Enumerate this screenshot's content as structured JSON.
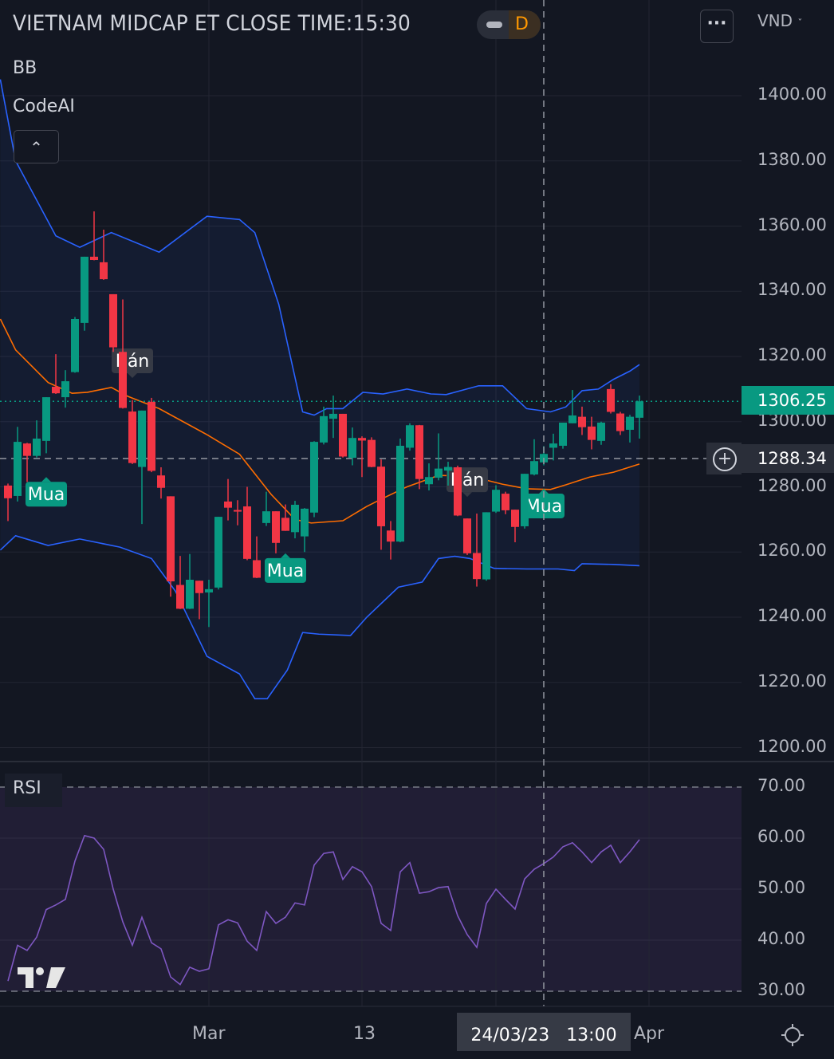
{
  "header": {
    "title": "VIETNAM MIDCAP ET CLOSE TIME:15:30",
    "interval": "D",
    "currency": "VND",
    "more_icon": "ellipsis-icon"
  },
  "legend": {
    "items": [
      "BB",
      "CodeAI"
    ],
    "collapse_icon": "chevron-up-icon",
    "rsi": "RSI"
  },
  "colors": {
    "up": "#089981",
    "down": "#f23645",
    "bb_band": "#2962ff",
    "bb_basis": "#ff6d00",
    "rsi": "#7e57c2",
    "price_tag": "#089981"
  },
  "price_axis": {
    "ticks": [
      "1400.00",
      "1380.00",
      "1360.00",
      "1340.00",
      "1320.00",
      "1300.00",
      "1280.00",
      "1260.00",
      "1240.00",
      "1220.00",
      "1200.00"
    ],
    "current": "1306.25",
    "crosshair": "1288.34"
  },
  "rsi_axis": {
    "ticks": [
      "70.00",
      "60.00",
      "50.00",
      "40.00",
      "30.00"
    ]
  },
  "time_axis": {
    "labels": [
      "Mar",
      "13",
      "Apr"
    ],
    "crosshair_date": "24/03/23",
    "crosshair_time": "13:00"
  },
  "chart_data": {
    "type": "candlestick",
    "title": "VIETNAM MIDCAP ET CLOSE TIME:15:30",
    "ylim": [
      1200,
      1410
    ],
    "rsi_ylim": [
      30,
      70
    ],
    "candles": [
      [
        1280.4,
        1281,
        1269.5,
        1276.5
      ],
      [
        1277.2,
        1298.4,
        1275.5,
        1293.8
      ],
      [
        1293.3,
        1293.5,
        1281.5,
        1289.5
      ],
      [
        1289.5,
        1300.4,
        1289,
        1294.8
      ],
      [
        1294.1,
        1307.5,
        1290.3,
        1307.5
      ],
      [
        1310.7,
        1320.7,
        1308.5,
        1308.7
      ],
      [
        1307.5,
        1315.8,
        1304.3,
        1312.4
      ],
      [
        1315.2,
        1332.1,
        1315,
        1331.5
      ],
      [
        1330.3,
        1350.6,
        1327.9,
        1350.6
      ],
      [
        1350.6,
        1364.5,
        1349.5,
        1349.6
      ],
      [
        1348.9,
        1358.9,
        1343.5,
        1343.7
      ],
      [
        1339.1,
        1339.1,
        1321.4,
        1322.8
      ],
      [
        1321.4,
        1337.5,
        1304,
        1304.2
      ],
      [
        1303.1,
        1306.6,
        1287,
        1287.3
      ],
      [
        1286.1,
        1303.4,
        1268.6,
        1303.4
      ],
      [
        1306.1,
        1307.3,
        1284.5,
        1284.9
      ],
      [
        1283.5,
        1286,
        1276.4,
        1279.7
      ],
      [
        1277.1,
        1277.1,
        1246.3,
        1251
      ],
      [
        1249.9,
        1258.8,
        1242.5,
        1242.6
      ],
      [
        1242.6,
        1259.4,
        1242.5,
        1251.5
      ],
      [
        1251.2,
        1251.2,
        1239.4,
        1247.4
      ],
      [
        1247.6,
        1251.5,
        1237,
        1248.6
      ],
      [
        1249.1,
        1270.8,
        1248.5,
        1270.8
      ],
      [
        1275.5,
        1282.4,
        1269.7,
        1273.6
      ],
      [
        1272.9,
        1275.9,
        1268.2,
        1272.4
      ],
      [
        1274,
        1280,
        1257.5,
        1257.9
      ],
      [
        1257.5,
        1264.8,
        1252,
        1252.1
      ],
      [
        1268.9,
        1278.5,
        1268,
        1272.5
      ],
      [
        1272.5,
        1272.5,
        1259.6,
        1262.8
      ],
      [
        1270.5,
        1274.6,
        1266.5,
        1266.5
      ],
      [
        1266.1,
        1275.7,
        1264.2,
        1274.5
      ],
      [
        1264.8,
        1273.5,
        1260,
        1273.3
      ],
      [
        1272.1,
        1294,
        1270.7,
        1293.8
      ],
      [
        1293.6,
        1304.6,
        1293,
        1301.7
      ],
      [
        1300.9,
        1308,
        1295,
        1302.4
      ],
      [
        1302.4,
        1302.4,
        1289,
        1289.3
      ],
      [
        1288.9,
        1298.2,
        1286.6,
        1295
      ],
      [
        1295,
        1295.5,
        1283,
        1294.2
      ],
      [
        1294.4,
        1295.2,
        1286,
        1286.1
      ],
      [
        1286.2,
        1288.4,
        1260.7,
        1267.9
      ],
      [
        1266.6,
        1269.5,
        1257.7,
        1263.2
      ],
      [
        1263.2,
        1294.8,
        1263,
        1292.6
      ],
      [
        1292,
        1299.5,
        1291.1,
        1298.9
      ],
      [
        1298.9,
        1299,
        1279.3,
        1282.4
      ],
      [
        1280.8,
        1287.2,
        1278.9,
        1283
      ],
      [
        1282.8,
        1296.4,
        1282,
        1285.6
      ],
      [
        1285,
        1287.7,
        1280.4,
        1286.1
      ],
      [
        1286,
        1286.5,
        1271,
        1271.2
      ],
      [
        1270.3,
        1270.3,
        1259.1,
        1259.6
      ],
      [
        1259.7,
        1271.8,
        1249.4,
        1251.7
      ],
      [
        1251.6,
        1272.2,
        1251.2,
        1272.2
      ],
      [
        1272.4,
        1280.5,
        1272,
        1279.1
      ],
      [
        1277.9,
        1278.5,
        1271.6,
        1272.8
      ],
      [
        1273,
        1273,
        1263,
        1267.7
      ],
      [
        1267.9,
        1284,
        1267.2,
        1284
      ],
      [
        1283.8,
        1294.6,
        1283.5,
        1287.9
      ],
      [
        1287.5,
        1292.5,
        1286.6,
        1290.1
      ],
      [
        1292,
        1296.3,
        1288.1,
        1293.3
      ],
      [
        1292.6,
        1299.7,
        1291.7,
        1299.7
      ],
      [
        1299.5,
        1309.7,
        1299.5,
        1301.9
      ],
      [
        1301.5,
        1304.6,
        1295.9,
        1298.3
      ],
      [
        1298.5,
        1301.5,
        1291.5,
        1294.4
      ],
      [
        1294.1,
        1300,
        1292.9,
        1299.7
      ],
      [
        1310,
        1311.5,
        1302.5,
        1303
      ],
      [
        1302.5,
        1303,
        1295.9,
        1297.1
      ],
      [
        1297.5,
        1302.1,
        1293.6,
        1301.5
      ],
      [
        1301.2,
        1308,
        1294.8,
        1306.25
      ]
    ],
    "bb_upper": [
      [
        -0.8,
        1405
      ],
      [
        0.8,
        1380
      ],
      [
        5,
        1357
      ],
      [
        7.5,
        1353.5
      ],
      [
        10.8,
        1358
      ],
      [
        15.8,
        1352
      ],
      [
        20.8,
        1363
      ],
      [
        24.2,
        1362
      ],
      [
        25.8,
        1358
      ],
      [
        28.3,
        1336
      ],
      [
        30.8,
        1303
      ],
      [
        32,
        1302
      ],
      [
        33.3,
        1304
      ],
      [
        35,
        1304
      ],
      [
        37.1,
        1309
      ],
      [
        39.2,
        1308.5
      ],
      [
        41.7,
        1310
      ],
      [
        44.2,
        1308.5
      ],
      [
        45.8,
        1308.3
      ],
      [
        49.2,
        1311
      ],
      [
        51.7,
        1311
      ],
      [
        54.2,
        1304
      ],
      [
        56.7,
        1303
      ],
      [
        58.3,
        1304.5
      ],
      [
        60,
        1309.5
      ],
      [
        61.7,
        1310
      ],
      [
        63.3,
        1313
      ],
      [
        65,
        1315.5
      ],
      [
        66,
        1317.5
      ]
    ],
    "bb_basis": [
      [
        -0.8,
        1331.5
      ],
      [
        0.8,
        1322
      ],
      [
        4.2,
        1312
      ],
      [
        6.7,
        1308.7
      ],
      [
        8.3,
        1309
      ],
      [
        10.8,
        1310.5
      ],
      [
        12.5,
        1307.8
      ],
      [
        15.8,
        1304
      ],
      [
        20.8,
        1296
      ],
      [
        24.2,
        1290
      ],
      [
        27.5,
        1277.7
      ],
      [
        30,
        1270
      ],
      [
        31.7,
        1268.9
      ],
      [
        35,
        1269.6
      ],
      [
        37.5,
        1274
      ],
      [
        39.2,
        1276.5
      ],
      [
        41.7,
        1280
      ],
      [
        45,
        1283.5
      ],
      [
        48.3,
        1283.3
      ],
      [
        51.7,
        1280.8
      ],
      [
        54.2,
        1279.4
      ],
      [
        56.7,
        1279.2
      ],
      [
        58.3,
        1280.6
      ],
      [
        60.8,
        1283
      ],
      [
        63.3,
        1284.5
      ],
      [
        66,
        1287
      ]
    ],
    "bb_lower": [
      [
        -0.8,
        1260.6
      ],
      [
        0.8,
        1265
      ],
      [
        4.2,
        1262
      ],
      [
        7.5,
        1264
      ],
      [
        11.7,
        1261.5
      ],
      [
        15,
        1258
      ],
      [
        17.5,
        1248
      ],
      [
        20.8,
        1228
      ],
      [
        24.2,
        1222.6
      ],
      [
        25.8,
        1215
      ],
      [
        27.1,
        1215
      ],
      [
        29.2,
        1223.8
      ],
      [
        30.8,
        1235.3
      ],
      [
        32.5,
        1234.8
      ],
      [
        35.8,
        1234.4
      ],
      [
        37.5,
        1240
      ],
      [
        40.8,
        1249.2
      ],
      [
        43.3,
        1250.8
      ],
      [
        45,
        1258
      ],
      [
        46.7,
        1258.7
      ],
      [
        48.3,
        1258
      ],
      [
        50.8,
        1255
      ],
      [
        54.2,
        1254.8
      ],
      [
        57.5,
        1254.8
      ],
      [
        59.2,
        1254.3
      ],
      [
        60,
        1256.4
      ],
      [
        63.3,
        1256.2
      ],
      [
        66,
        1255.8
      ]
    ],
    "rsi": [
      32,
      39,
      38,
      40.6,
      46,
      46.9,
      48,
      55.5,
      60.5,
      60,
      57.8,
      50,
      43.6,
      39,
      44.5,
      39.5,
      38.3,
      32.8,
      31.3,
      34.7,
      33.9,
      34.4,
      43,
      44,
      43.4,
      39.8,
      38,
      45.6,
      43.3,
      44.5,
      47.3,
      46.9,
      54.7,
      57,
      57.3,
      51.9,
      54.4,
      53.4,
      50.5,
      43.3,
      41.9,
      53.4,
      55.2,
      49.2,
      49.5,
      50.3,
      50.5,
      44.8,
      41.1,
      38.6,
      47.2,
      50,
      48,
      46.1,
      52,
      53.9,
      55,
      56.3,
      58.3,
      59.1,
      57.3,
      55.2,
      57.3,
      58.6,
      55.2,
      57.3,
      59.7
    ],
    "signals": [
      {
        "label": "Mua",
        "bar": 4,
        "price": 1283.0,
        "kind": "buy"
      },
      {
        "label": "Bán",
        "bar": 13,
        "price": 1313.4,
        "kind": "sell"
      },
      {
        "label": "Mua",
        "bar": 29,
        "price": 1259.6,
        "kind": "buy"
      },
      {
        "label": "Bán",
        "bar": 48,
        "price": 1276.9,
        "kind": "sell"
      },
      {
        "label": "Mua",
        "bar": 56,
        "price": 1279.4,
        "kind": "buy"
      }
    ],
    "crosshair": {
      "bar": 56,
      "price": 1288.34
    }
  }
}
